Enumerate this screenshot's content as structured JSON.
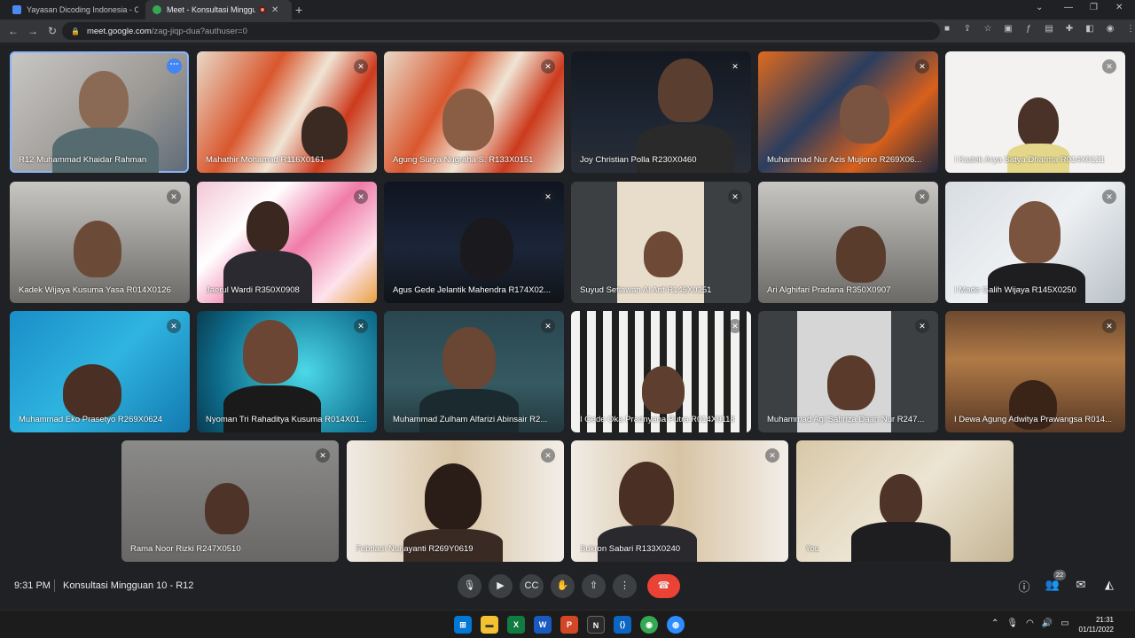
{
  "browser": {
    "tabs": [
      {
        "title": "Yayasan Dicoding Indonesia - Ca",
        "favicon_color": "#4a8af4"
      },
      {
        "title": "Meet - Konsultasi Mingguan",
        "favicon_color": "#34a853"
      }
    ],
    "url_host": "meet.google.com",
    "url_path": "/zag-jiqp-dua?authuser=0"
  },
  "participants": [
    "R12 Muhammad Khaidar Rahman",
    "Mahathir Mohamad R116X0161",
    "Agung Surya Nugraha S. R133X0151",
    "Joy Christian Polla R230X0460",
    "Muhammad Nur Azis Mujiono R269X06...",
    "I Kadek Arya Satya Dharma R014X0121",
    "Kadek Wijaya Kusuma Yasa R014X0126",
    "Jaerul Wardi R350X0908",
    "Agus Gede Jelantik Mahendra R174X02...",
    "Suyud Setiawan Al Arif R145X0251",
    "Ari Alghifari Pradana R350X0907",
    "I Made Galih Wijaya R145X0250",
    "Muhammad Eko Prasetyo R269X0624",
    "Nyoman Tri Rahaditya Kusuma R014X01...",
    "Muhammad Zulham Alfarizi Abinsair R2...",
    "I Gede Oka Pradnyana Putra R014X0118",
    "Muhammad Agi Sahriza Daan Nur R247...",
    "I Dewa Agung Adwitya Prawangsa R014...",
    "Rama Noor Rizki R247X0510",
    "Febriani Nurjayanti R269Y0619",
    "Sukron Sabari R133X0240",
    "You"
  ],
  "meeting": {
    "time": "9:31 PM",
    "title": "Konsultasi Mingguan 10 - R12",
    "participant_count": "22"
  },
  "taskbar": {
    "time": "21:31",
    "date": "01/11/2022"
  }
}
